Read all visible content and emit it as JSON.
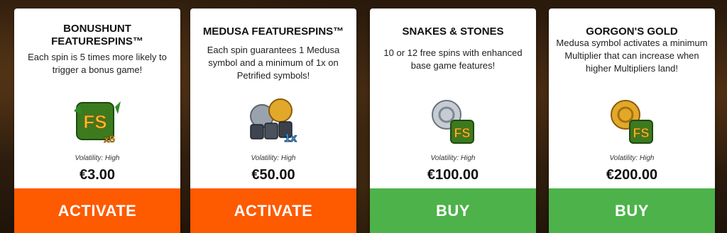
{
  "cards": [
    {
      "title": "BONUSHUNT FEATURESPINS™",
      "description": "Each spin is 5 times more likely to trigger a bonus game!",
      "icon": "fs-x5-icon",
      "volatility": "Volatility: High",
      "price": "€3.00",
      "button": "ACTIVATE",
      "button_color": "#fe5a00"
    },
    {
      "title": "MEDUSA FEATURESPINS™",
      "description": "Each spin guarantees 1 Medusa symbol and a minimum of 1x on Petrified symbols!",
      "icon": "medusa-1x-icon",
      "volatility": "Volatility: High",
      "price": "€50.00",
      "button": "ACTIVATE",
      "button_color": "#fe5a00"
    },
    {
      "title": "SNAKES & STONES",
      "description": "10 or 12 free spins with enhanced base game features!",
      "icon": "snakes-stones-icon",
      "volatility": "Volatility: High",
      "price": "€100.00",
      "button": "BUY",
      "button_color": "#4db24a"
    },
    {
      "title": "GORGON'S GOLD",
      "description": "Medusa symbol activates a minimum Multiplier that can increase when higher Multipliers land!",
      "icon": "gorgons-gold-icon",
      "volatility": "Volatility: High",
      "price": "€200.00",
      "button": "BUY",
      "button_color": "#4db24a"
    }
  ],
  "icon_labels": {
    "fs": "FS",
    "x5": "x5",
    "one_x": "1x"
  }
}
